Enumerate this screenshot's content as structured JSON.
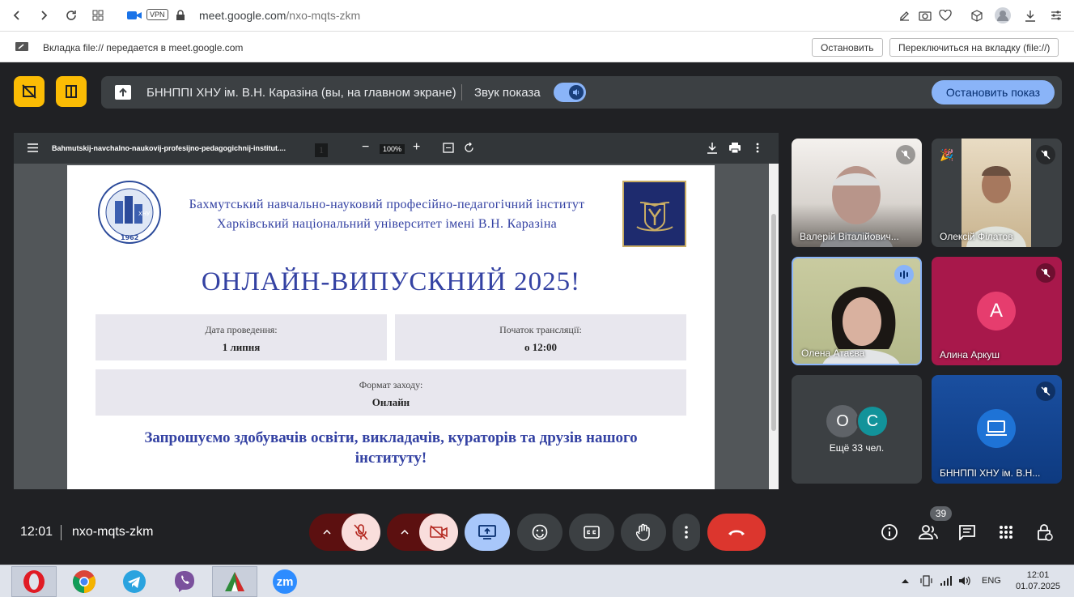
{
  "browser": {
    "url_host": "meet.google.com",
    "url_path": "/nxo-mqts-zkm",
    "vpn_label": "VPN"
  },
  "share_bar": {
    "text": "Вкладка file:// передается в meet.google.com",
    "stop_label": "Остановить",
    "switch_label": "Переключиться на вкладку (file://)"
  },
  "presentation_bar": {
    "title": "БННППІ ХНУ ім. В.Н. Каразіна (вы, на главном экране)",
    "sound_label": "Звук показа",
    "stop_label": "Остановить показ"
  },
  "pdf_viewer": {
    "filename": "Bahmutskij-navchalno-naukovij-profesijno-pedagogichnij-institut....",
    "page_current": "1",
    "page_total": "1",
    "zoom": "100%"
  },
  "document": {
    "header_line1": "Бахмутський навчально-науковий професійно-педагогічний інститут",
    "header_line2": "Харківський національний університет імені В.Н. Каразіна",
    "logo_year": "1962",
    "logo_letters": "ХНУ",
    "title": "ОНЛАЙН-ВИПУСКНИЙ 2025!",
    "date_label": "Дата проведення:",
    "date_value": "1 липня",
    "start_label": "Початок трансляції:",
    "start_value": "о 12:00",
    "format_label": "Формат заходу:",
    "format_value": "Онлайн",
    "invite": "Запрошуємо здобувачів освіти, викладачів, кураторів та друзів нашого інституту!"
  },
  "participants": [
    {
      "name": "Валерій Віталійович...",
      "muted": true
    },
    {
      "name": "Олексій Філатов",
      "muted": true
    },
    {
      "name": "Олена Атаєва",
      "speaking": true
    },
    {
      "name": "Алина Аркуш",
      "muted": true,
      "initial": "А"
    },
    {
      "name": "Ещё 33 чел.",
      "initials": [
        "О",
        "С"
      ]
    },
    {
      "name": "БННППІ ХНУ ім. В.Н...",
      "muted": true
    }
  ],
  "meeting": {
    "time": "12:01",
    "code": "nxo-mqts-zkm",
    "participant_count": "39"
  },
  "taskbar": {
    "lang": "ENG",
    "time": "12:01",
    "date": "01.07.2025",
    "zoom_label": "zm"
  }
}
